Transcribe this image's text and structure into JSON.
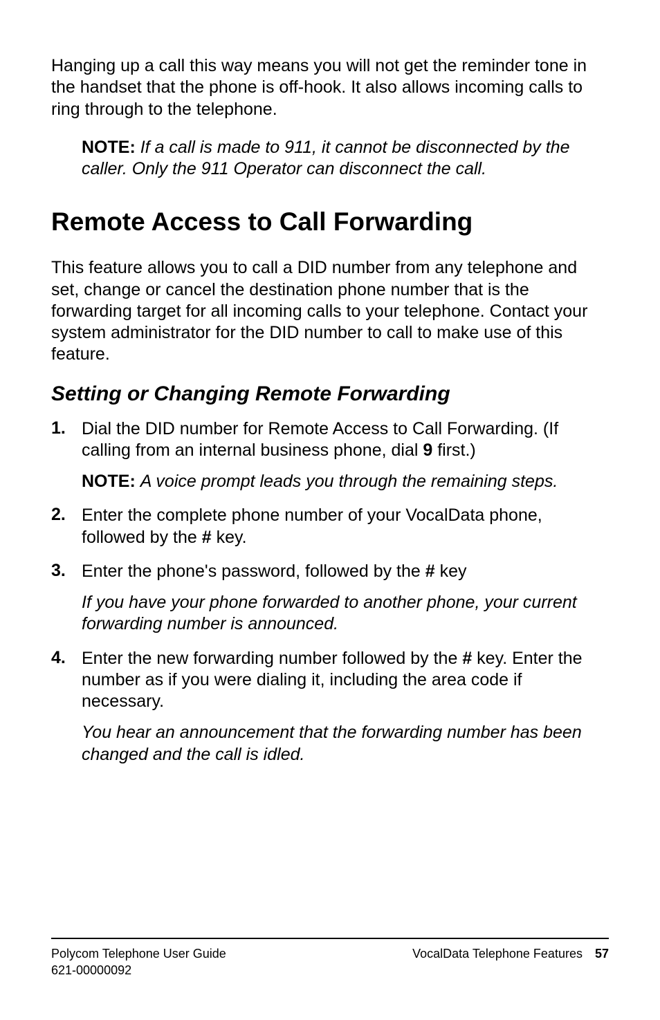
{
  "intro": {
    "para1": "Hanging up a call this way means you will not get the reminder tone in the handset that the phone is off-hook. It also allows incoming calls to ring through to the telephone.",
    "note_label": "NOTE:",
    "note_text": "If a call is made to 911, it cannot be disconnected by the caller. Only the 911 Operator can disconnect the call."
  },
  "section": {
    "title": "Remote Access to Call Forwarding",
    "para": "This feature allows you to call a DID number from any telephone and set, change or cancel the destination phone number that is the forwarding target for all incoming calls to your telephone. Contact your system administrator for the DID number to call to make use of this feature."
  },
  "subsection": {
    "title": "Setting or Changing Remote Forwarding"
  },
  "steps": {
    "s1_a": "Dial the DID number for Remote Access to Call Forwarding. (If calling from an internal business phone, dial ",
    "s1_bold": "9",
    "s1_b": " first.)",
    "s1_note_label": "NOTE:",
    "s1_note_text": "A voice prompt leads you through the remaining steps.",
    "s2_a": "Enter the complete phone number of your VocalData phone, followed by the ",
    "s2_bold": "#",
    "s2_b": " key.",
    "s3_a": "Enter the phone's password, followed by the ",
    "s3_bold": "#",
    "s3_b": " key",
    "s3_result": "If you have your phone forwarded to another phone, your current forwarding number is announced.",
    "s4_a": "Enter the new forwarding number followed by the ",
    "s4_bold": "#",
    "s4_b": " key. Enter the number as if you were dialing it, including the area code if necessary.",
    "s4_result": "You hear an announcement that the forwarding number has been changed and the call is idled."
  },
  "footer": {
    "left_line1": "Polycom Telephone User Guide",
    "left_line2": "621-00000092",
    "right_text": "VocalData Telephone Features",
    "page_num": "57"
  }
}
